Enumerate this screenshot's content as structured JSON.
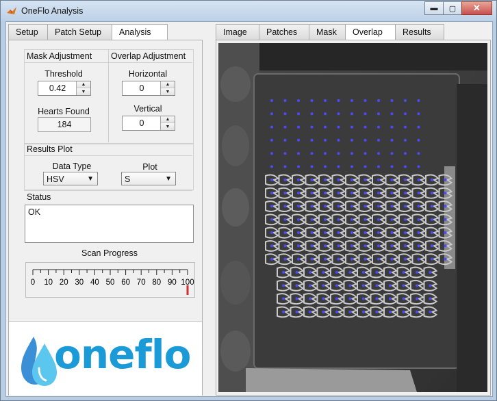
{
  "window": {
    "title": "OneFlo Analysis",
    "icon": "matlab-icon",
    "minimize_glyph": "▬",
    "maximize_glyph": "▢",
    "close_glyph": "✕"
  },
  "left_tabs": [
    {
      "label": "Setup"
    },
    {
      "label": "Patch Setup"
    },
    {
      "label": "Analysis"
    }
  ],
  "right_tabs": [
    {
      "label": "Image"
    },
    {
      "label": "Patches"
    },
    {
      "label": "Mask"
    },
    {
      "label": "Overlap"
    },
    {
      "label": "Results"
    }
  ],
  "mask_adjustment": {
    "title": "Mask Adjustment",
    "threshold_label": "Threshold",
    "threshold_value": "0.42",
    "hearts_found_label": "Hearts Found",
    "hearts_found_value": "184"
  },
  "overlap_adjustment": {
    "title": "Overlap Adjustment",
    "horizontal_label": "Horizontal",
    "horizontal_value": "0",
    "vertical_label": "Vertical",
    "vertical_value": "0"
  },
  "results_plot": {
    "title": "Results Plot",
    "data_type_label": "Data Type",
    "data_type_value": "HSV",
    "plot_label": "Plot",
    "plot_value": "S"
  },
  "status": {
    "title": "Status",
    "text": "OK"
  },
  "scan_progress": {
    "title": "Scan Progress",
    "ticks": [
      "0",
      "10",
      "20",
      "30",
      "40",
      "50",
      "60",
      "70",
      "80",
      "90",
      "100"
    ],
    "value": 100,
    "marker_color": "#d03030"
  },
  "logo": {
    "text": "oneflo",
    "color": "#1a9ad6",
    "drop_colors": [
      "#3b8fd6",
      "#5bc6ee"
    ]
  },
  "spinner": {
    "up": "▲",
    "down": "▼"
  },
  "dropdown_caret": "▼",
  "overlay_point_color": "#4a4aff"
}
